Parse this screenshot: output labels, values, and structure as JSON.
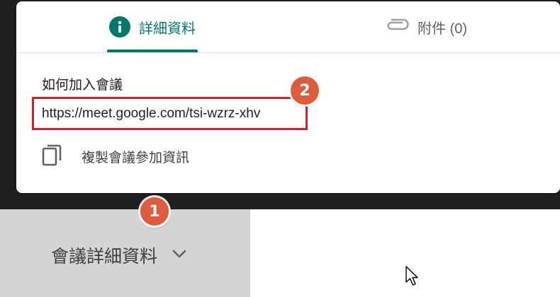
{
  "tabs": {
    "details_label": "詳細資料",
    "attachments_label": "附件 (0)"
  },
  "join": {
    "heading": "如何加入會議",
    "meeting_url": "https://meet.google.com/tsi-wzrz-xhv",
    "copy_label": "複製會議參加資訊"
  },
  "badges": {
    "step_one": "1",
    "step_two": "2"
  },
  "toggle": {
    "label": "會議詳細資料"
  },
  "icons": {
    "info": "info-icon",
    "attachment": "paperclip-icon",
    "copy": "copy-icon",
    "chevron": "chevron-down-icon",
    "cursor": "mouse-pointer-icon"
  },
  "colors": {
    "accent_teal": "#00796b",
    "highlight_red": "#e0182d",
    "badge_orange": "#de5b3c"
  }
}
